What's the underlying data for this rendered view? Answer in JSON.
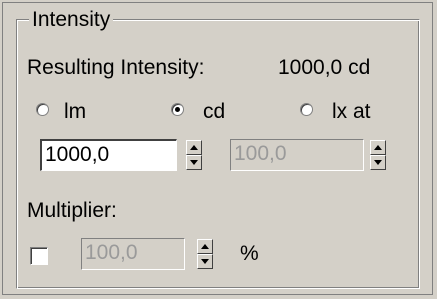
{
  "group": {
    "title": "Intensity"
  },
  "resulting": {
    "label": "Resulting Intensity:",
    "value": "1000,0 cd"
  },
  "units": [
    {
      "label": "lm",
      "checked": false
    },
    {
      "label": "cd",
      "checked": true
    },
    {
      "label": "lx at",
      "checked": false
    }
  ],
  "intensity_field": {
    "value": "1000,0",
    "enabled": true
  },
  "distance_field": {
    "value": "100,0",
    "enabled": false
  },
  "multiplier": {
    "label": "Multiplier:",
    "checked": false,
    "value": "100,0",
    "enabled": false,
    "unit": "%"
  }
}
